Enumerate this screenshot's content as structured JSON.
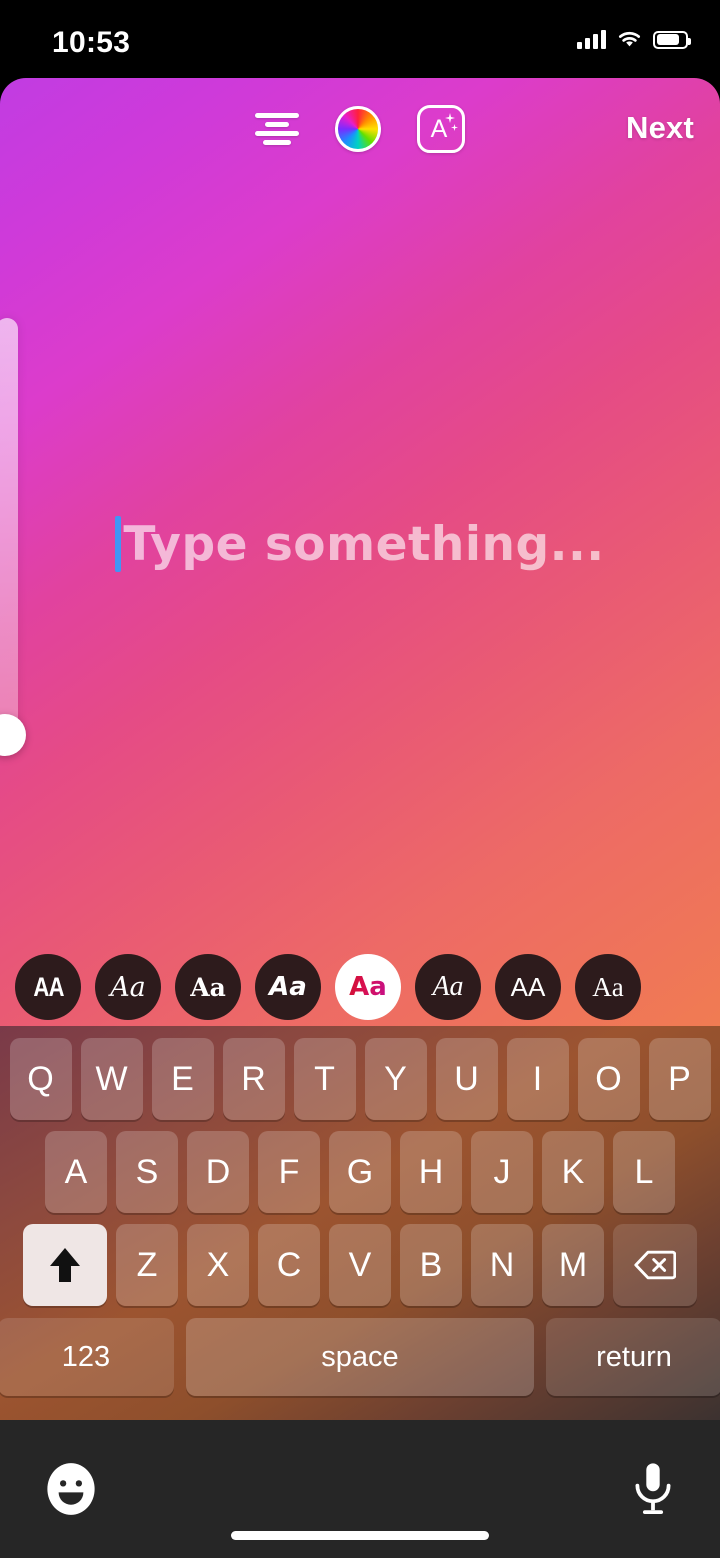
{
  "status_bar": {
    "time": "10:53",
    "signal_icon": "cellular-signal-icon",
    "wifi_icon": "wifi-icon",
    "battery_icon": "battery-icon",
    "battery_level_pct": 75
  },
  "toolbar": {
    "align_icon": "text-align-icon",
    "color_icon": "color-wheel-icon",
    "effects_icon": "text-effects-a-plus-icon",
    "effects_letter": "A",
    "next_label": "Next"
  },
  "canvas": {
    "placeholder": "Type something...",
    "caret_color": "#3f96f5",
    "gradient_start": "#c13ce2",
    "gradient_mid": "#e54b86",
    "gradient_end": "#f07c52",
    "size_slider": {
      "name": "text-size-slider",
      "thumb_position_pct": 94
    }
  },
  "font_row": {
    "chips": [
      {
        "label": "AA",
        "style": "f-cond",
        "name": "font-chip-condensed",
        "selected": false
      },
      {
        "label": "Aa",
        "style": "f-scr",
        "name": "font-chip-script",
        "selected": false
      },
      {
        "label": "Aa",
        "style": "f-slab",
        "name": "font-chip-slab",
        "selected": false
      },
      {
        "label": "Aa",
        "style": "f-bital",
        "name": "font-chip-bold-italic",
        "selected": false
      },
      {
        "label": "Aa",
        "style": "f-round",
        "name": "font-chip-rounded",
        "selected": true
      },
      {
        "label": "Aa",
        "style": "f-sital",
        "name": "font-chip-serif-italic",
        "selected": false
      },
      {
        "label": "AA",
        "style": "f-sans",
        "name": "font-chip-sans",
        "selected": false
      },
      {
        "label": "Aa",
        "style": "f-serif",
        "name": "font-chip-serif",
        "selected": false
      }
    ]
  },
  "keyboard": {
    "row1": [
      "Q",
      "W",
      "E",
      "R",
      "T",
      "Y",
      "U",
      "I",
      "O",
      "P"
    ],
    "row2": [
      "A",
      "S",
      "D",
      "F",
      "G",
      "H",
      "J",
      "K",
      "L"
    ],
    "row3": [
      "Z",
      "X",
      "C",
      "V",
      "B",
      "N",
      "M"
    ],
    "shift_icon": "shift-arrow-icon",
    "shift_active": true,
    "backspace_icon": "backspace-delete-icon",
    "numbers_label": "123",
    "space_label": "space",
    "return_label": "return"
  },
  "bottom_bar": {
    "emoji_icon": "emoji-smiley-icon",
    "mic_icon": "microphone-icon",
    "home_indicator": "home-indicator-bar"
  }
}
